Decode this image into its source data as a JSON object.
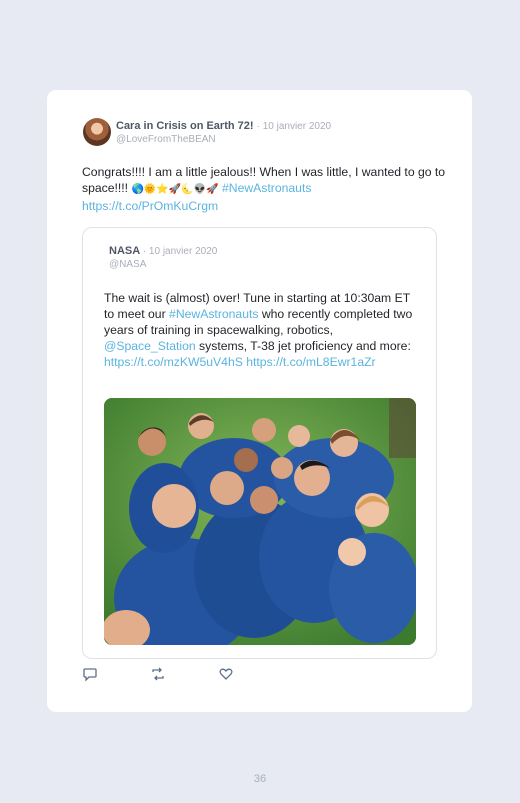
{
  "tweet": {
    "author_name": "Cara in Crisis on Earth 72!",
    "date": "· 10 janvier 2020",
    "handle": "@LoveFromTheBEAN",
    "text_main": "Congrats!!!! I am a little jealous!! When I was little, I wanted to go to space!!!! ",
    "emojis": "🌎🌞⭐🚀🌜👽🚀",
    "hashtag": "#NewAstronauts",
    "link": "https://t.co/PrOmKuCrgm"
  },
  "quote": {
    "author_name": "NASA",
    "date": "· 10 janvier 2020",
    "handle": "@NASA",
    "text_part1": "The wait is (almost) over! Tune in starting at 10:30am ET to meet our ",
    "hashtag": "#NewAstronauts",
    "text_part2": " who recently completed two years of training in spacewalking, robotics, ",
    "mention": "@Space_Station",
    "text_part3": " systems, T-38 jet proficiency and more:",
    "link1": "https://t.co/mzKW5uV4hS",
    "link2": "https://t.co/mL8Ewr1aZr"
  },
  "actions": {
    "reply_icon": "reply-icon",
    "retweet_icon": "retweet-icon",
    "like_icon": "like-icon"
  },
  "page_number": "36",
  "colors": {
    "background": "#e7eaf3",
    "card": "#ffffff",
    "link": "#5ab4df",
    "suit": "#24549f"
  }
}
